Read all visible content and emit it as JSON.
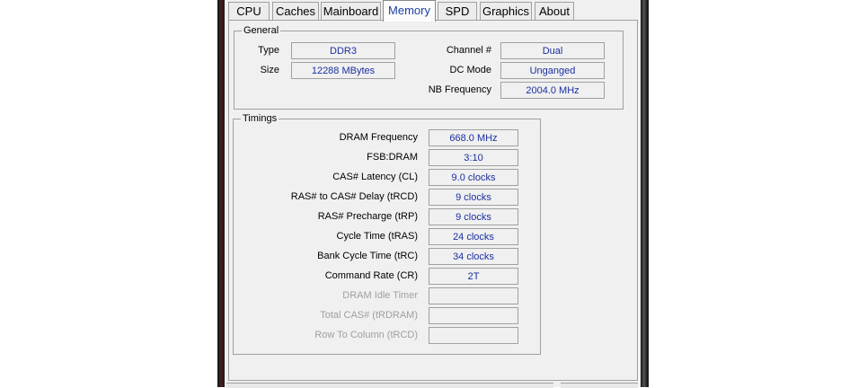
{
  "tabs": [
    {
      "label": "CPU"
    },
    {
      "label": "Caches"
    },
    {
      "label": "Mainboard"
    },
    {
      "label": "Memory"
    },
    {
      "label": "SPD"
    },
    {
      "label": "Graphics"
    },
    {
      "label": "About"
    }
  ],
  "active_tab": "Memory",
  "general": {
    "title": "General",
    "type_label": "Type",
    "type_value": "DDR3",
    "size_label": "Size",
    "size_value": "12288 MBytes",
    "channel_label": "Channel #",
    "channel_value": "Dual",
    "dc_mode_label": "DC Mode",
    "dc_mode_value": "Unganged",
    "nb_freq_label": "NB Frequency",
    "nb_freq_value": "2004.0 MHz"
  },
  "timings": {
    "title": "Timings",
    "rows": [
      {
        "label": "DRAM Frequency",
        "value": "668.0 MHz"
      },
      {
        "label": "FSB:DRAM",
        "value": "3:10"
      },
      {
        "label": "CAS# Latency (CL)",
        "value": "9.0 clocks"
      },
      {
        "label": "RAS# to CAS# Delay (tRCD)",
        "value": "9 clocks"
      },
      {
        "label": "RAS# Precharge (tRP)",
        "value": "9 clocks"
      },
      {
        "label": "Cycle Time (tRAS)",
        "value": "24 clocks"
      },
      {
        "label": "Bank Cycle Time (tRC)",
        "value": "34 clocks"
      },
      {
        "label": "Command Rate (CR)",
        "value": "2T"
      },
      {
        "label": "DRAM Idle Timer",
        "value": ""
      },
      {
        "label": "Total CAS# (tRDRAM)",
        "value": ""
      },
      {
        "label": "Row To Column (tRCD)",
        "value": ""
      }
    ]
  },
  "colors": {
    "value_text": "#1a2ea0",
    "active_tab_text": "#1a3fa8",
    "disabled_label": "#a0a0a0"
  }
}
